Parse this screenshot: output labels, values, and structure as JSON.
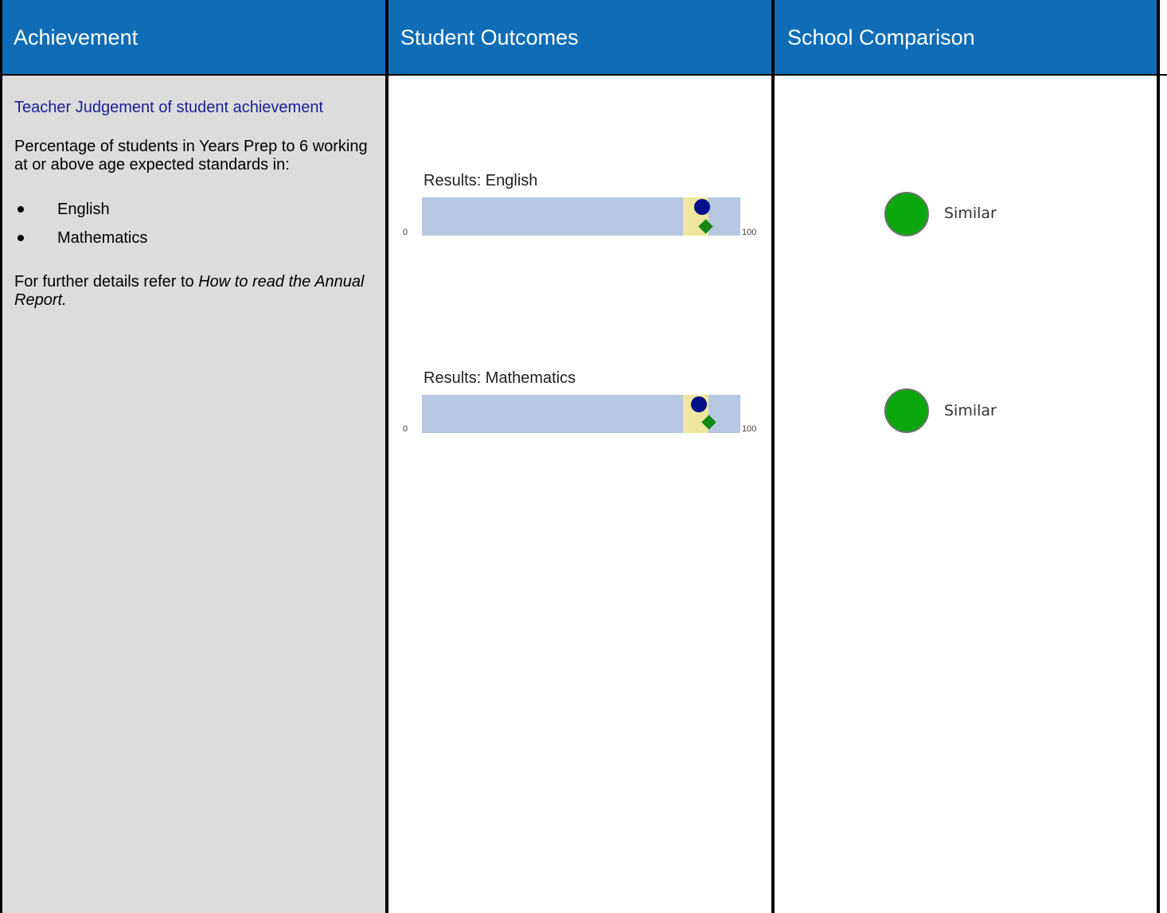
{
  "headers": {
    "achievement": "Achievement",
    "student_outcomes": "Student Outcomes",
    "school_comparison": "School Comparison"
  },
  "achievement": {
    "title": "Teacher Judgement of student achievement",
    "description": "Percentage of students in Years Prep to 6 working at or above age expected standards in:",
    "subjects": [
      "English",
      "Mathematics"
    ],
    "footer_prefix": "For further details refer to ",
    "footer_emphasis": "How to read the Annual Report."
  },
  "results": [
    {
      "label": "Results: English",
      "axis_min": "0",
      "axis_max": "100",
      "school_value": 88,
      "similar_schools_value": 89,
      "range": [
        82,
        90
      ],
      "comparison": "Similar"
    },
    {
      "label": "Results: Mathematics",
      "axis_min": "0",
      "axis_max": "100",
      "school_value": 87,
      "similar_schools_value": 90,
      "range": [
        82,
        90
      ],
      "comparison": "Similar"
    }
  ],
  "colors": {
    "header_bg": "#0f6db7",
    "bar": "#b6c7e1",
    "band": "#efe79d",
    "school_marker": "#03108a",
    "similar_marker": "#118812",
    "comparison_similar": "#0aa80c"
  }
}
